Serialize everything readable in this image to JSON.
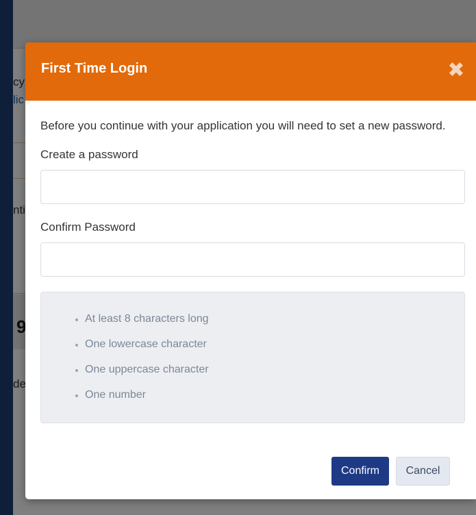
{
  "background": {
    "snippets": [
      "cy",
      "lic",
      "nti",
      "de"
    ],
    "glyph": "9"
  },
  "modal": {
    "title": "First Time Login",
    "close_symbol": "✖",
    "intro": "Before you continue with your application you will need to set a new password.",
    "create_label": "Create a password",
    "create_value": "",
    "confirm_label": "Confirm Password",
    "confirm_value": "",
    "requirements": [
      "At least 8 characters long",
      "One lowercase character",
      "One uppercase character",
      "One number"
    ],
    "confirm_button": "Confirm",
    "cancel_button": "Cancel"
  },
  "colors": {
    "header": "#e26a0a",
    "primary_button": "#1e3a86",
    "sidebar": "#1f3e72"
  }
}
